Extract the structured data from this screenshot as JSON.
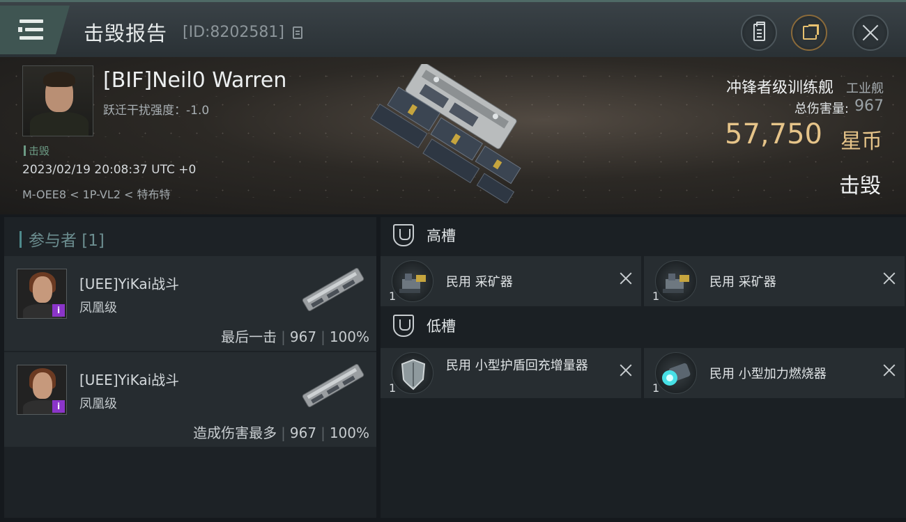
{
  "header": {
    "title": "击毁报告",
    "report_id": "[ID:8202581]"
  },
  "victim": {
    "name": "[BIF]Neil0 Warren",
    "warp_scramble": "跃迁干扰强度：-1.0",
    "status_tag": "击毁",
    "timestamp": "2023/02/19 20:08:37 UTC +0",
    "location": "M-OEE8 < 1P-VL2 < 特布特",
    "ship_name": "冲锋者级训练舰",
    "ship_class": "工业舰",
    "total_damage_label": "总伤害量:",
    "total_damage_value": "967",
    "isk_value": "57,750",
    "isk_unit": "星币",
    "result": "击毁"
  },
  "participants": {
    "header": "参与者 [1]",
    "items": [
      {
        "name": "[UEE]YiKai战斗",
        "ship": "凤凰级",
        "role": "最后一击",
        "damage": "967",
        "percent": "100%",
        "badge": "i"
      },
      {
        "name": "[UEE]YiKai战斗",
        "ship": "凤凰级",
        "role": "造成伤害最多",
        "damage": "967",
        "percent": "100%",
        "badge": "i"
      }
    ]
  },
  "fitting": {
    "high_slots_label": "高槽",
    "low_slots_label": "低槽",
    "high": [
      {
        "name": "民用 采矿器",
        "qty": "1",
        "icon": "mining-laser-icon"
      },
      {
        "name": "民用 采矿器",
        "qty": "1",
        "icon": "mining-laser-icon"
      }
    ],
    "low": [
      {
        "name": "民用 小型护盾回充增量器",
        "qty": "1",
        "icon": "shield-extender-icon"
      },
      {
        "name": "民用 小型加力燃烧器",
        "qty": "1",
        "icon": "afterburner-icon"
      }
    ]
  },
  "colors": {
    "accent_teal": "#4e8a8c",
    "isk_gold": "#e6c489",
    "badge_purple": "#8b35c9"
  }
}
